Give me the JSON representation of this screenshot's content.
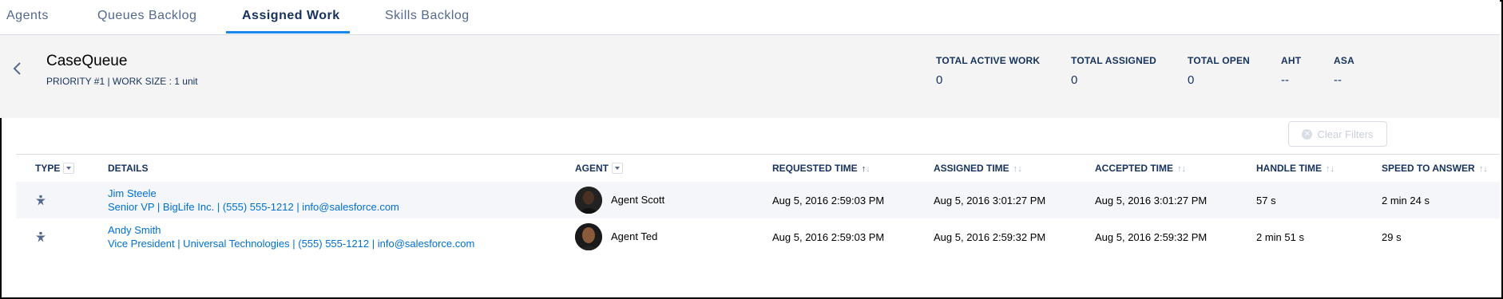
{
  "tabs": [
    {
      "label": "Agents"
    },
    {
      "label": "Queues Backlog"
    },
    {
      "label": "Assigned Work"
    },
    {
      "label": "Skills Backlog"
    }
  ],
  "queue": {
    "name": "CaseQueue",
    "meta": "PRIORITY #1  | WORK SIZE : 1 unit"
  },
  "stats": [
    {
      "label": "TOTAL ACTIVE WORK",
      "value": "0"
    },
    {
      "label": "TOTAL ASSIGNED",
      "value": "0"
    },
    {
      "label": "TOTAL OPEN",
      "value": "0"
    },
    {
      "label": "AHT",
      "value": "--"
    },
    {
      "label": "ASA",
      "value": "--"
    }
  ],
  "clear_filters": "Clear Filters",
  "columns": {
    "type": "TYPE",
    "details": "DETAILS",
    "agent": "AGENT",
    "requested": "REQUESTED TIME",
    "assigned": "ASSIGNED TIME",
    "accepted": "ACCEPTED TIME",
    "handle": "HANDLE TIME",
    "speed": "SPEED TO ANSWER"
  },
  "rows": [
    {
      "type_icon": "case-icon",
      "name": "Jim Steele",
      "details": "Senior VP | BigLife Inc. | (555) 555-1212 | info@salesforce.com",
      "agent": "Agent Scott",
      "requested": "Aug 5, 2016 2:59:03 PM",
      "assigned": "Aug 5, 2016 3:01:27 PM",
      "accepted": "Aug 5, 2016 3:01:27 PM",
      "handle": "57 s",
      "speed": "2 min 24 s"
    },
    {
      "type_icon": "case-icon",
      "name": "Andy Smith",
      "details": "Vice President | Universal Technologies | (555) 555-1212 | info@salesforce.com",
      "agent": "Agent Ted",
      "requested": "Aug 5, 2016 2:59:03 PM",
      "assigned": "Aug 5, 2016 2:59:32 PM",
      "accepted": "Aug 5, 2016 2:59:32 PM",
      "handle": "2 min 51 s",
      "speed": "29 s"
    }
  ]
}
